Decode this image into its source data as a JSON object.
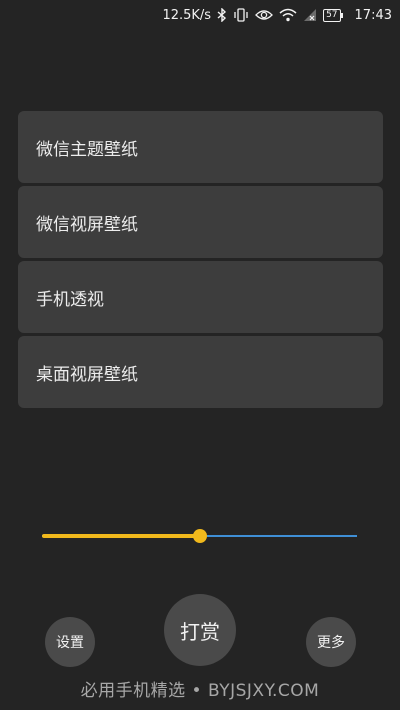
{
  "status_bar": {
    "net_speed": "12.5K/s",
    "battery": "57",
    "time": "17:43",
    "icons": [
      "bluetooth-icon",
      "vibrate-icon",
      "eye-icon",
      "wifi-icon",
      "no-sim-icon",
      "battery-icon"
    ]
  },
  "menu": {
    "items": [
      {
        "label": "微信主题壁纸"
      },
      {
        "label": "微信视屏壁纸"
      },
      {
        "label": "手机透视"
      },
      {
        "label": "桌面视屏壁纸"
      }
    ]
  },
  "slider": {
    "value": 0.5,
    "fill_color": "#f1b91c",
    "track_color": "#3f8fd6"
  },
  "buttons": {
    "settings": "设置",
    "reward": "打赏",
    "more": "更多"
  },
  "watermark": "必用手机精选 • BYJSJXY.COM"
}
